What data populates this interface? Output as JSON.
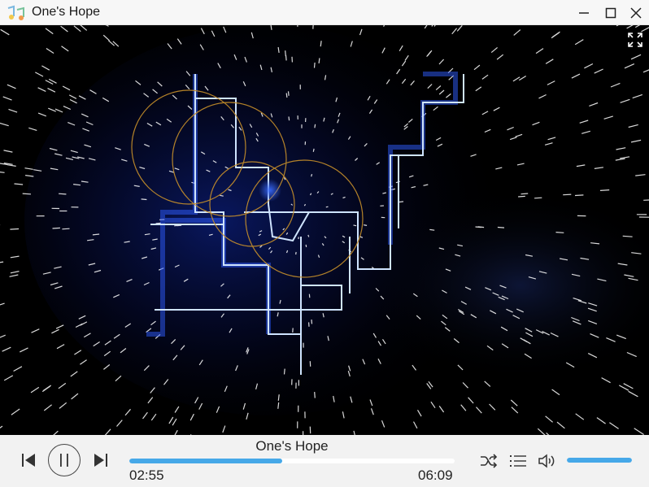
{
  "window": {
    "title": "One's Hope",
    "icon": "music-notes-icon"
  },
  "player": {
    "track_title": "One's Hope",
    "current_time": "02:55",
    "total_time": "06:09",
    "progress": 0.47,
    "volume": 1.0,
    "accent_color": "#46a8e8"
  },
  "controls": {
    "previous": "previous-track-icon",
    "play_pause": "pause-icon",
    "next": "next-track-icon",
    "shuffle": "shuffle-icon",
    "playlist": "playlist-icon",
    "volume": "speaker-icon",
    "fullscreen": "fullscreen-icon"
  }
}
